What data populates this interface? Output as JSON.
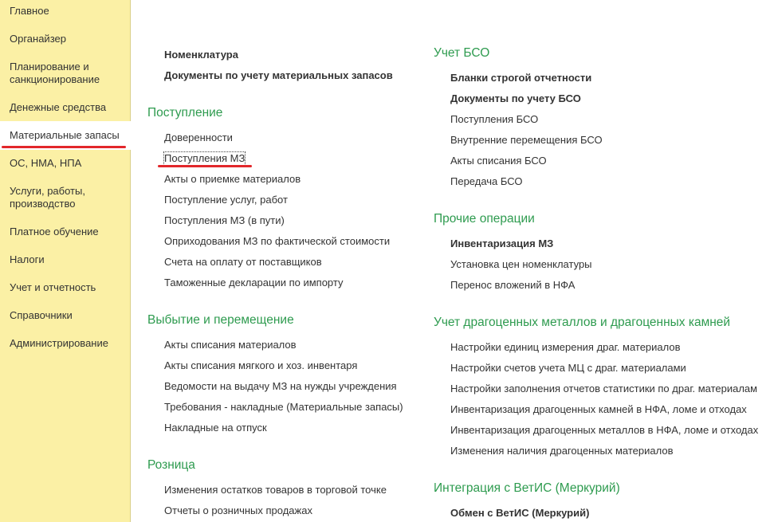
{
  "sidebar": {
    "items": [
      {
        "label": "Главное"
      },
      {
        "label": "Органайзер"
      },
      {
        "label": "Планирование и санкционирование"
      },
      {
        "label": "Денежные средства"
      },
      {
        "label": "Материальные запасы"
      },
      {
        "label": "ОС, НМА, НПА"
      },
      {
        "label": "Услуги, работы, производство"
      },
      {
        "label": "Платное обучение"
      },
      {
        "label": "Налоги"
      },
      {
        "label": "Учет и отчетность"
      },
      {
        "label": "Справочники"
      },
      {
        "label": "Администрирование"
      }
    ],
    "active_index": 4
  },
  "left_column": {
    "top_links": [
      {
        "label": "Номенклатура"
      },
      {
        "label": "Документы по учету материальных запасов"
      }
    ],
    "sections": [
      {
        "title": "Поступление",
        "links": [
          {
            "label": "Доверенности"
          },
          {
            "label": "Поступления МЗ"
          },
          {
            "label": "Акты о приемке материалов"
          },
          {
            "label": "Поступление услуг, работ"
          },
          {
            "label": "Поступления МЗ (в пути)"
          },
          {
            "label": "Оприходования МЗ по фактической стоимости"
          },
          {
            "label": "Счета на оплату от поставщиков"
          },
          {
            "label": "Таможенные декларации по импорту"
          }
        ]
      },
      {
        "title": "Выбытие и перемещение",
        "links": [
          {
            "label": "Акты списания материалов"
          },
          {
            "label": "Акты списания мягкого и хоз. инвентаря"
          },
          {
            "label": "Ведомости на выдачу МЗ на нужды учреждения"
          },
          {
            "label": "Требования - накладные (Материальные запасы)"
          },
          {
            "label": "Накладные на отпуск"
          }
        ]
      },
      {
        "title": "Розница",
        "links": [
          {
            "label": "Изменения остатков товаров в торговой точке"
          },
          {
            "label": "Отчеты о розничных продажах"
          }
        ]
      }
    ]
  },
  "right_column": {
    "sections": [
      {
        "title": "Учет БСО",
        "links": [
          {
            "label": "Бланки строгой отчетности",
            "bold": true
          },
          {
            "label": "Документы по учету БСО",
            "bold": true
          },
          {
            "label": "Поступления БСО"
          },
          {
            "label": "Внутренние перемещения БСО"
          },
          {
            "label": "Акты списания БСО"
          },
          {
            "label": "Передача БСО"
          }
        ]
      },
      {
        "title": "Прочие операции",
        "links": [
          {
            "label": "Инвентаризация МЗ",
            "bold": true
          },
          {
            "label": "Установка цен номенклатуры"
          },
          {
            "label": "Перенос вложений в НФА"
          }
        ]
      },
      {
        "title": "Учет драгоценных металлов и драгоценных камней",
        "links": [
          {
            "label": "Настройки единиц измерения драг. материалов"
          },
          {
            "label": "Настройки счетов учета МЦ с драг. материалами"
          },
          {
            "label": "Настройки заполнения отчетов статистики по драг. материалам"
          },
          {
            "label": "Инвентаризация драгоценных камней в НФА, ломе и отходах"
          },
          {
            "label": "Инвентаризация драгоценных металлов в НФА, ломе и отходах"
          },
          {
            "label": "Изменения наличия драгоценных материалов"
          }
        ]
      },
      {
        "title": "Интеграция с ВетИС (Меркурий)",
        "links": [
          {
            "label": "Обмен с ВетИС (Меркурий)",
            "bold": true
          }
        ]
      }
    ]
  },
  "colors": {
    "sidebar_bg": "#fbf0a5",
    "section_title": "#2e9b4f",
    "highlight_underline": "#e2272b"
  }
}
